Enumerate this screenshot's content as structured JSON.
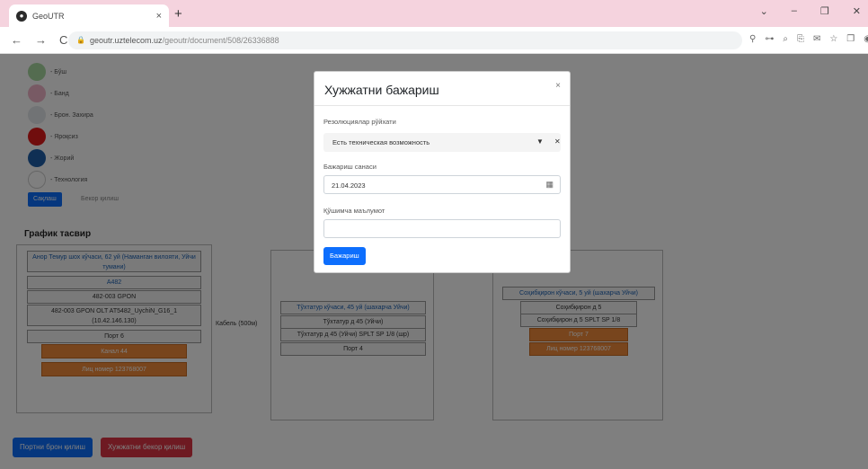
{
  "browser": {
    "tab_title": "GeoUTR",
    "tab_close": "×",
    "new_tab": "+",
    "window_controls": [
      "⌄",
      "–",
      "❐",
      "✕"
    ],
    "nav": [
      "←",
      "→",
      "C"
    ],
    "url_host": "geoutr.uztelecom.uz",
    "url_path": "/geoutr/document/508/26336888",
    "toolbar_icons": [
      "⚲",
      "⊶",
      "⌕",
      "⎘",
      "✉",
      "☆",
      "❐",
      "◉"
    ]
  },
  "legend": [
    {
      "label": "- Бўш",
      "color": "#a8d8a0"
    },
    {
      "label": "- Банд",
      "color": "#f0b4c8"
    },
    {
      "label": "- Брон. Захира",
      "color": "#e2e6ea"
    },
    {
      "label": "- Яроқсиз",
      "color": "#e11a1a"
    },
    {
      "label": "- Жорий",
      "color": "#1f5fa8"
    },
    {
      "label": "- Технология",
      "color": "#ffffff"
    }
  ],
  "buttons": {
    "save": "Сақлаш",
    "delete": "Бекор қилиш"
  },
  "graph": {
    "title": "График тасвир",
    "scheme1": {
      "header": "Анор Темур шох кўчаси, 62 уй (Наманган вилояти, Уйчи тумани)",
      "a482": "А482",
      "olt": "482-003 GPON",
      "olt_full": "482-003 GPON OLT AT5482_UychiN_G16_1 (10.42.146.130)",
      "port": "Порт 6",
      "kanal": "Канал 44",
      "lic": "Лиц номер 123768007"
    },
    "cable": "Кабель (500м)",
    "scheme2": {
      "header": "Тўхтатур кўчаси, 45 уй (шахарча Уйчи)",
      "splitter": "Тўхтатур д 45 (Уйчи)",
      "splitter_full": "Тўхтатур д 45 (Уйчи) SPLT SP 1/8 (шр)",
      "port": "Порт 4"
    },
    "scheme3": {
      "header": "Соҳибқирон кўчаси, 5 уй (шахарча Уйчи)",
      "splitter": "Соҳибқирон д 5",
      "splitter_full": "Соҳибқирон д 5 SPLT SP 1/8",
      "port": "Порт 7",
      "lic": "Лиц номер 123768007"
    }
  },
  "footer": {
    "btn_reserve": "Портни брон қилиш",
    "btn_cancel": "Хужжатни бекор қилиш"
  },
  "modal": {
    "title": "Хужжатни бажариш",
    "close": "×",
    "result_label": "Резолюциялар рўйхати",
    "result_value": "Есть техническая возможность",
    "date_label": "Бажариш санаси",
    "date_value": "21.04.2023",
    "info_label": "Қўшимча маълумот",
    "info_value": "",
    "submit": "Бажариш"
  }
}
